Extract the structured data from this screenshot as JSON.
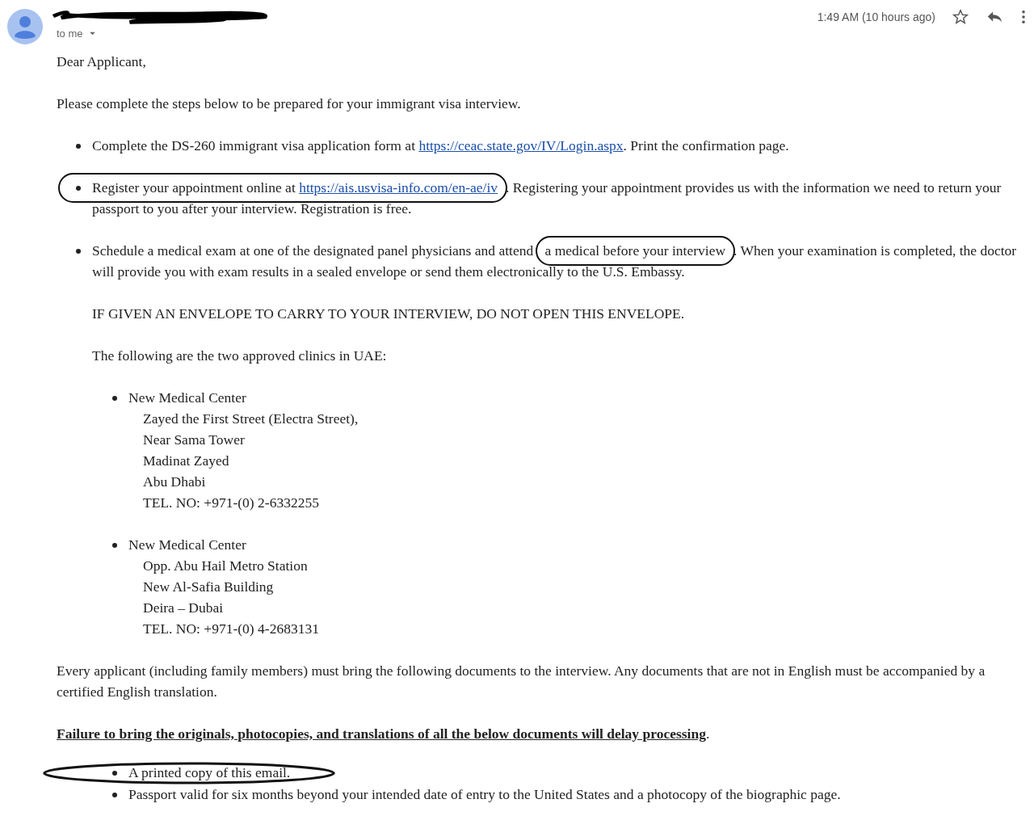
{
  "header": {
    "sender_redacted": true,
    "recipient": "to me",
    "time": "1:49 AM (10 hours ago)"
  },
  "greeting": "Dear Applicant,",
  "intro": "Please complete the steps below to be prepared for your immigrant visa interview.",
  "steps": [
    {
      "paragraphs": [
        [
          {
            "kind": "text",
            "text": "Complete the DS-260 immigrant visa application form at "
          },
          {
            "kind": "link",
            "text": "https://ceac.state.gov/IV/Login.aspx"
          },
          {
            "kind": "text",
            "text": ".  Print the confirmation page."
          }
        ]
      ]
    },
    {
      "paragraphs": [
        [
          {
            "kind": "circled",
            "parts": [
              {
                "kind": "text",
                "text": "Register your appointment online at "
              },
              {
                "kind": "link",
                "text": "https://ais.usvisa-info.com/en-ae/iv"
              }
            ]
          },
          {
            "kind": "text",
            "text": ". Registering your appointment provides us with the information we need to return your passport to you after your interview. Registration is free."
          }
        ]
      ]
    },
    {
      "paragraphs": [
        [
          {
            "kind": "text",
            "text": "Schedule a medical exam at one of the designated panel physicians and attend "
          },
          {
            "kind": "circled",
            "parts": [
              {
                "kind": "text",
                "text": "a medical before your interview"
              }
            ]
          },
          {
            "kind": "text",
            "text": ". When your examination is completed, the doctor will provide you with exam results in a sealed envelope or send them electronically to the U.S. Embassy."
          }
        ],
        [
          {
            "kind": "text",
            "text": "IF GIVEN AN ENVELOPE TO CARRY TO YOUR INTERVIEW, DO NOT OPEN THIS ENVELOPE."
          }
        ],
        [
          {
            "kind": "text",
            "text": "The following are the two approved clinics in UAE:"
          }
        ]
      ],
      "clinics": [
        {
          "name": "New Medical Center",
          "address": [
            "Zayed the First Street (Electra Street),",
            "Near Sama Tower",
            "Madinat Zayed",
            "Abu Dhabi",
            "TEL. NO: +971-(0) 2-6332255"
          ]
        },
        {
          "name": "New Medical Center",
          "address": [
            "Opp. Abu Hail Metro Station",
            "New Al-Safia Building",
            "Deira – Dubai",
            "TEL. NO: +971-(0) 4-2683131"
          ]
        }
      ]
    }
  ],
  "documents_note": "Every applicant (including family members) must bring the following documents to the interview. Any documents that are not in English must be accompanied by a certified English translation.",
  "warning": [
    {
      "kind": "strong",
      "text": "Failure to bring the originals, photocopies, and translations of all the below documents will delay processing"
    },
    {
      "kind": "text",
      "text": "."
    }
  ],
  "documents": [
    {
      "text": "A printed copy of this email.",
      "circled": true
    },
    {
      "text": "Passport valid for six months beyond your intended date of entry to the United States and a photocopy of the biographic page.",
      "circled": false
    }
  ]
}
